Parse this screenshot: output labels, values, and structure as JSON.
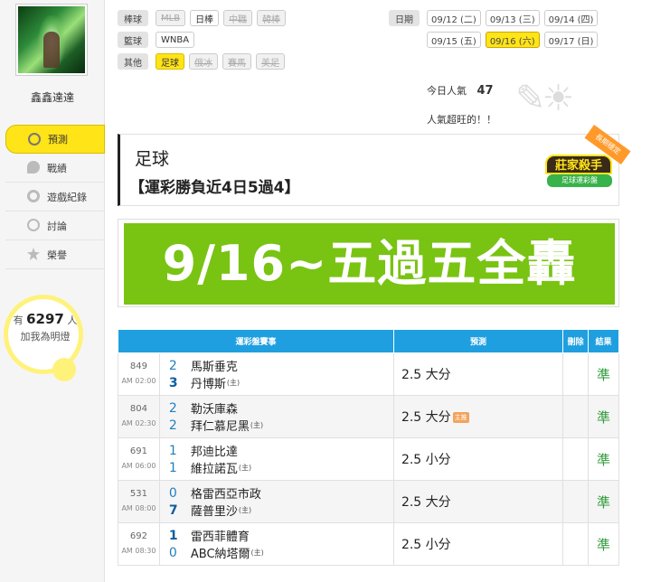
{
  "sidebar": {
    "username": "鑫鑫達達",
    "items": [
      {
        "label": "預測",
        "icon": "target-icon",
        "active": true
      },
      {
        "label": "戰績",
        "icon": "chat-bubble-icon"
      },
      {
        "label": "遊戲紀錄",
        "icon": "circle-icon"
      },
      {
        "label": "討論",
        "icon": "discuss-icon"
      },
      {
        "label": "榮譽",
        "icon": "star-icon"
      }
    ],
    "bulb": {
      "prefix": "有",
      "count": "6297",
      "suffix": "人",
      "line2": "加我為明燈"
    }
  },
  "filters": {
    "rows": [
      {
        "category": "棒球",
        "chips": [
          {
            "label": "MLB",
            "state": "disabled"
          },
          {
            "label": "日棒",
            "state": "normal"
          },
          {
            "label": "中職",
            "state": "disabled"
          },
          {
            "label": "韓棒",
            "state": "disabled"
          }
        ]
      },
      {
        "category": "籃球",
        "chips": [
          {
            "label": "WNBA",
            "state": "normal"
          }
        ]
      },
      {
        "category": "其他",
        "chips": [
          {
            "label": "足球",
            "state": "selected"
          },
          {
            "label": "俄冰",
            "state": "disabled"
          },
          {
            "label": "賽馬",
            "state": "disabled"
          },
          {
            "label": "美足",
            "state": "disabled"
          }
        ]
      }
    ]
  },
  "dates": {
    "label": "日期",
    "row1": [
      "09/12 (二)",
      "09/13 (三)",
      "09/14 (四)"
    ],
    "row2": [
      "09/15 (五)",
      "09/16 (六)",
      "09/17 (日)"
    ],
    "selected": "09/16 (六)"
  },
  "popularity": {
    "label": "今日人氣",
    "value": "47",
    "note": "人氣超旺的！！"
  },
  "header": {
    "sport": "足球",
    "subtitle": "【運彩勝負近4日5過4】",
    "badge_main": "莊家殺手",
    "badge_sub": "足球運彩盤",
    "badge_corner": "長期穩定"
  },
  "banner": {
    "text": "9/16~五過五全轟"
  },
  "table": {
    "headers": [
      "運彩盤賽事",
      "預測",
      "刪除",
      "結果"
    ],
    "home_mark": "(主)",
    "rows": [
      {
        "id": "849",
        "time": "AM 02:00",
        "away_score": "2",
        "away": "馬斯垂克",
        "home_score": "3",
        "home": "丹博斯",
        "winner": "home",
        "pick": "2.5 大分",
        "tag": "",
        "result": "準"
      },
      {
        "id": "804",
        "time": "AM 02:30",
        "away_score": "2",
        "away": "勒沃庫森",
        "home_score": "2",
        "home": "拜仁慕尼黑",
        "winner": "",
        "pick": "2.5 大分",
        "tag": "主推",
        "result": "準"
      },
      {
        "id": "691",
        "time": "AM 06:00",
        "away_score": "1",
        "away": "邦迪比達",
        "home_score": "1",
        "home": "維拉諾瓦",
        "winner": "",
        "pick": "2.5 小分",
        "tag": "",
        "result": "準"
      },
      {
        "id": "531",
        "time": "AM 08:00",
        "away_score": "0",
        "away": "格雷西亞市政",
        "home_score": "7",
        "home": "薩普里沙",
        "winner": "home",
        "pick": "2.5 大分",
        "tag": "",
        "result": "準"
      },
      {
        "id": "692",
        "time": "AM 08:30",
        "away_score": "1",
        "away": "雷西菲體育",
        "home_score": "0",
        "home": "ABC納塔爾",
        "winner": "away",
        "pick": "2.5 小分",
        "tag": "",
        "result": "準"
      }
    ]
  }
}
